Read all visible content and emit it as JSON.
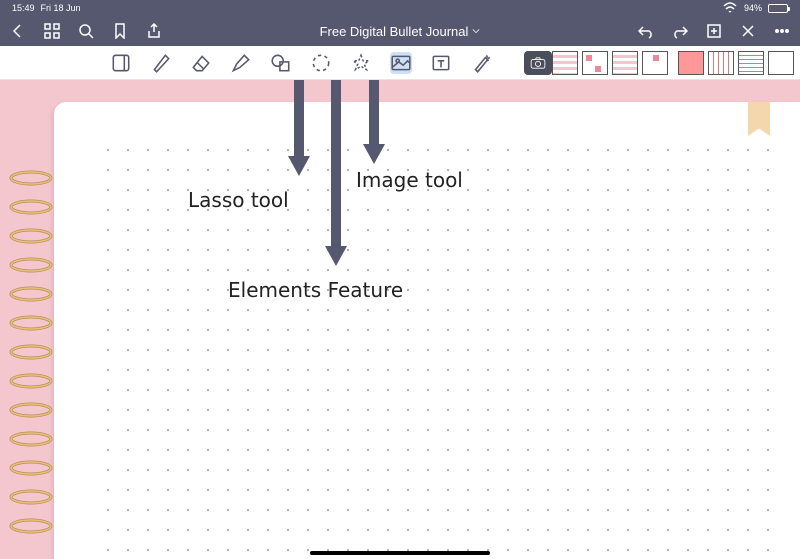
{
  "status": {
    "time": "15:49",
    "date": "Fri 18 Jun",
    "battery_pct": "94%"
  },
  "header": {
    "title": "Free Digital Bullet Journal"
  },
  "tools": {
    "read_only": "read-only",
    "pen": "pen",
    "eraser": "eraser",
    "highlighter": "highlighter",
    "shapes": "shapes",
    "lasso": "lasso",
    "elements": "elements",
    "image": "image",
    "text": "text",
    "laser": "laser",
    "camera": "camera"
  },
  "annotations": {
    "lasso_label": "Lasso tool",
    "elements_label": "Elements Feature",
    "image_label": "Image tool"
  }
}
